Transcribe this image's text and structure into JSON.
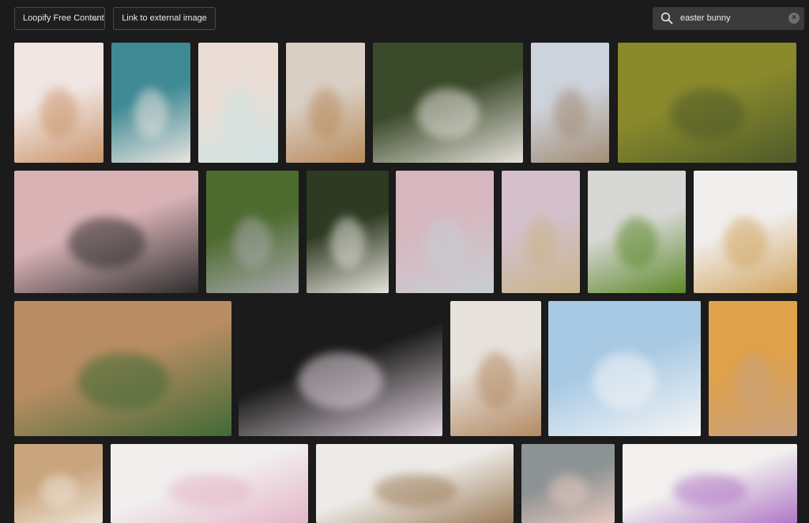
{
  "toolbar": {
    "source_label": "Loopify Free Content",
    "source_icon": "chevron-down-icon",
    "link_label": "Link to external image"
  },
  "search": {
    "value": "easter bunny",
    "icon": "search-icon",
    "clear_icon": "clear-icon"
  },
  "results": [
    {
      "name": "chocolate-bunny-photo",
      "colors": [
        "#f1e6e3",
        "#c9956a"
      ]
    },
    {
      "name": "lop-bunny-teal-photo",
      "colors": [
        "#3f8a95",
        "#e9e4df"
      ]
    },
    {
      "name": "pastel-easter-decor-photo",
      "colors": [
        "#e9ddd6",
        "#cfe3e2"
      ]
    },
    {
      "name": "easter-cookies-tray-photo",
      "colors": [
        "#d9cfc4",
        "#b98a5c"
      ]
    },
    {
      "name": "white-brown-bunny-photo",
      "colors": [
        "#3b4a2a",
        "#e5e1db"
      ]
    },
    {
      "name": "person-in-bunny-suit-photo",
      "colors": [
        "#cdd3da",
        "#a48d76"
      ]
    },
    {
      "name": "wild-rabbit-grass-photo",
      "colors": [
        "#8a8a2c",
        "#4e5b2a"
      ]
    },
    {
      "name": "black-bunny-flowers-photo",
      "colors": [
        "#d9b2b6",
        "#2d2d2d"
      ]
    },
    {
      "name": "grey-bunny-log-photo",
      "colors": [
        "#4d6b2f",
        "#a9a9ad"
      ]
    },
    {
      "name": "white-bunny-forest-photo",
      "colors": [
        "#2e3a22",
        "#e5e3dc"
      ]
    },
    {
      "name": "pastel-eggs-closeup-photo",
      "colors": [
        "#d7b7bf",
        "#c7cfd4"
      ]
    },
    {
      "name": "mini-eggs-pattern-photo",
      "colors": [
        "#d3c0cb",
        "#c9b58a"
      ]
    },
    {
      "name": "cat-in-bunny-ears-photo",
      "colors": [
        "#d7d7d5",
        "#5e8a2a"
      ]
    },
    {
      "name": "cracked-egg-white-photo",
      "colors": [
        "#f0efed",
        "#d2a560"
      ]
    },
    {
      "name": "wooden-table-greenery-photo",
      "colors": [
        "#b98d63",
        "#3f6a35"
      ]
    },
    {
      "name": "lego-bunny-minifig-photo",
      "colors": [
        "#1a1a1a",
        "#e4d7e0"
      ]
    },
    {
      "name": "hands-holding-bunny-photo",
      "colors": [
        "#e6e1db",
        "#b48a63"
      ]
    },
    {
      "name": "paper-bunnies-blue-photo",
      "colors": [
        "#a7c9e4",
        "#f6f6f6"
      ]
    },
    {
      "name": "bunny-face-orange-photo",
      "colors": [
        "#e0a24a",
        "#c9a27f"
      ]
    },
    {
      "name": "eggs-in-basket-photo",
      "colors": [
        "#c9a57d",
        "#efe3d6"
      ]
    },
    {
      "name": "easter-cupcakes-photo",
      "colors": [
        "#f1eeee",
        "#e4b6c8"
      ]
    },
    {
      "name": "easter-table-flatlay-photo",
      "colors": [
        "#ecebe7",
        "#9c7b58"
      ]
    },
    {
      "name": "egg-wreath-door-photo",
      "colors": [
        "#8d9394",
        "#e7c8bf"
      ]
    },
    {
      "name": "egg-basket-lilacs-photo",
      "colors": [
        "#f2f1ef",
        "#b076c6"
      ]
    }
  ]
}
